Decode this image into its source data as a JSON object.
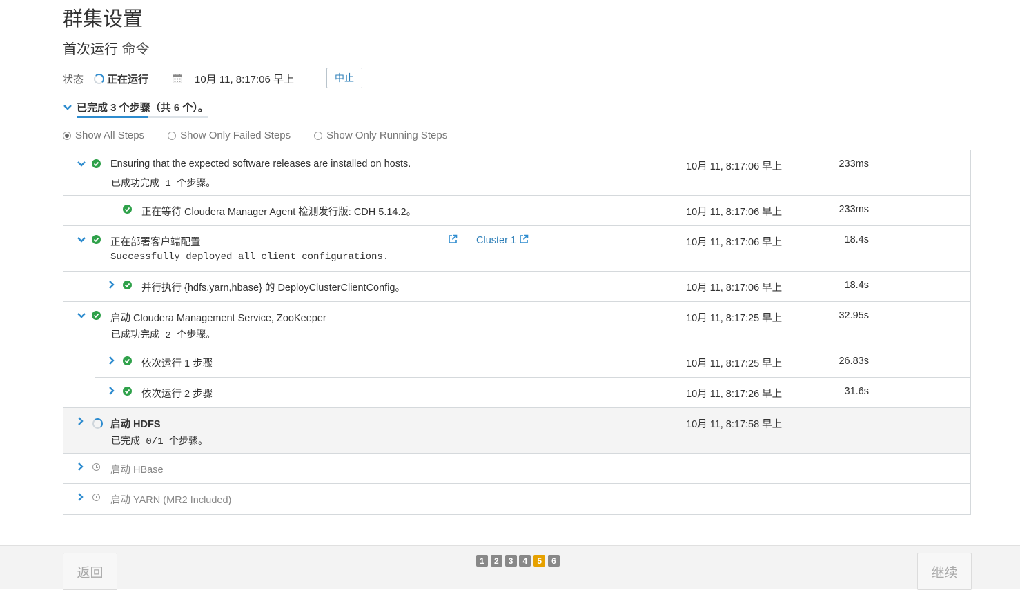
{
  "header": {
    "title": "群集设置",
    "subtitle_main": "首次运行",
    "subtitle_suffix": " 命令"
  },
  "status": {
    "label": "状态",
    "value": "正在运行",
    "time": "10月 11, 8:17:06 早上",
    "abort_label": "中止"
  },
  "summary": {
    "text": "已完成 3 个步骤（共 6 个）。"
  },
  "filters": [
    {
      "label": "Show All Steps",
      "checked": true
    },
    {
      "label": "Show Only Failed Steps",
      "checked": false
    },
    {
      "label": "Show Only Running Steps",
      "checked": false
    }
  ],
  "steps": {
    "s1": {
      "name": "Ensuring that the expected software releases are installed on hosts.",
      "detail_a": "已成功完成",
      "detail_b": " 1 ",
      "detail_c": "个步骤。",
      "time": "10月 11, 8:17:06 早上",
      "duration": "233ms",
      "status": "succeeded"
    },
    "s1a": {
      "name": "正在等待 Cloudera Manager Agent 检测发行版: CDH 5.14.2。",
      "time": "10月 11, 8:17:06 早上",
      "duration": "233ms",
      "status": "succeeded"
    },
    "s2": {
      "name": "正在部署客户端配置",
      "cluster_link": "Cluster 1",
      "detail": "Successfully deployed all client configurations.",
      "time": "10月 11, 8:17:06 早上",
      "duration": "18.4s",
      "status": "succeeded"
    },
    "s2a": {
      "name": "并行执行 {hdfs,yarn,hbase} 的 DeployClusterClientConfig。",
      "time": "10月 11, 8:17:06 早上",
      "duration": "18.4s",
      "status": "succeeded"
    },
    "s3": {
      "name": "启动 Cloudera Management Service, ZooKeeper",
      "detail_a": "已成功完成",
      "detail_b": " 2 ",
      "detail_c": "个步骤。",
      "time": "10月 11, 8:17:25 早上",
      "duration": "32.95s",
      "status": "succeeded"
    },
    "s3a": {
      "name": "依次运行 1 步骤",
      "time": "10月 11, 8:17:25 早上",
      "duration": "26.83s",
      "status": "succeeded"
    },
    "s3b": {
      "name": "依次运行 2 步骤",
      "time": "10月 11, 8:17:26 早上",
      "duration": "31.6s",
      "status": "succeeded"
    },
    "s4": {
      "name": "启动 HDFS",
      "detail_a": "已完成",
      "detail_b": " 0/1 ",
      "detail_c": "个步骤。",
      "time": "10月 11, 8:17:58 早上",
      "status": "running"
    },
    "s5": {
      "name": "启动 HBase",
      "status": "pending"
    },
    "s6": {
      "name": "启动 YARN (MR2 Included)",
      "status": "pending"
    }
  },
  "footer": {
    "back_label": "返回",
    "next_label": "继续",
    "pages": [
      "1",
      "2",
      "3",
      "4",
      "5",
      "6"
    ],
    "current_page": "5"
  },
  "colors": {
    "accent": "#2e8ccf",
    "success": "#2fa14a",
    "current_page": "#e6a100"
  }
}
